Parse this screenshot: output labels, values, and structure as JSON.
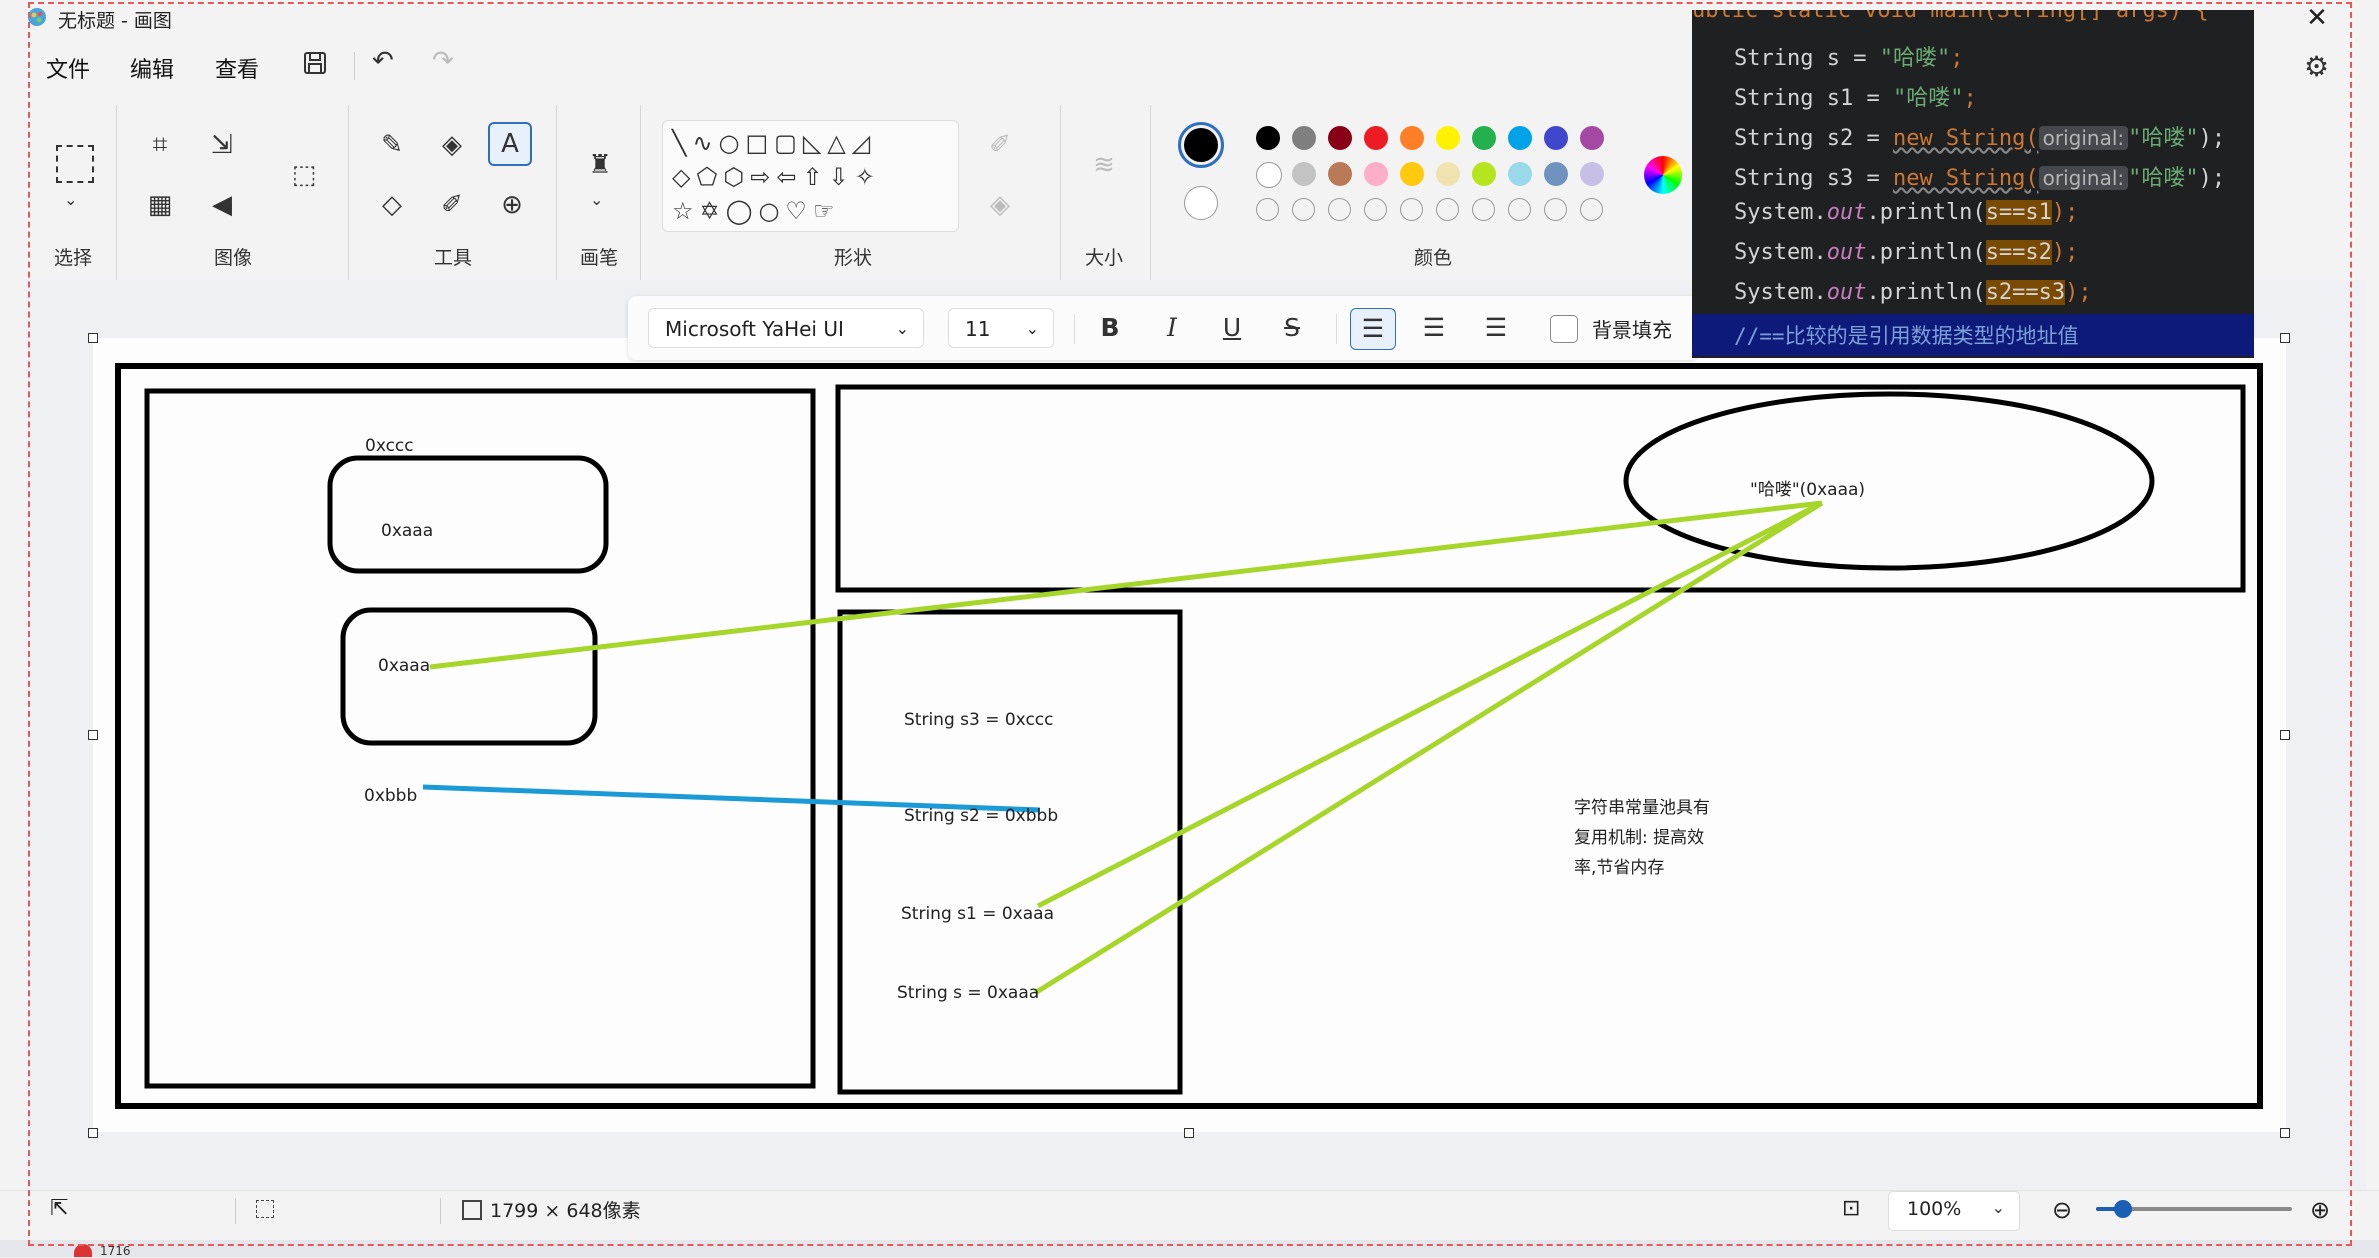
{
  "window": {
    "title": "无标题 - 画图",
    "close_glyph": "✕"
  },
  "menu": {
    "file": "文件",
    "edit": "编辑",
    "view": "查看"
  },
  "ribbon": {
    "groups": {
      "select": "选择",
      "image": "图像",
      "tools": "工具",
      "brush": "画笔",
      "shapes": "形状",
      "size": "大小",
      "colors": "颜色"
    },
    "palette_row1": [
      "#000000",
      "#7f7f7f",
      "#880015",
      "#ed1c24",
      "#ff7f27",
      "#fff200",
      "#22b14c",
      "#00a2e8",
      "#3f48cc",
      "#a349a4"
    ],
    "palette_row2": [
      "#ffffff",
      "#c3c3c3",
      "#b97a57",
      "#ffaec9",
      "#ffc90e",
      "#efe4b0",
      "#b5e61d",
      "#99d9ea",
      "#7092be",
      "#c8bfe7"
    ],
    "color1": "#000000",
    "color2": "#ffffff"
  },
  "text_toolbar": {
    "font": "Microsoft YaHei UI",
    "size": "11",
    "bold": "B",
    "italic": "I",
    "underline": "U",
    "strike": "S",
    "bg_fill": "背景填充"
  },
  "canvas_labels": {
    "addr_xccc": "0xccc",
    "addr_xaaa_1": "0xaaa",
    "addr_xaaa_2": "0xaaa",
    "addr_xbbb": "0xbbb",
    "pool_value": "\"哈喽\"(0xaaa)",
    "s3": "String s3 = 0xccc",
    "s2": "String s2 = 0xbbb",
    "s1": "String s1 = 0xaaa",
    "s": "String s = 0xaaa",
    "note_line1": "字符串常量池具有",
    "note_line2": "复用机制: 提高效",
    "note_line3": "率,节省内存"
  },
  "code": {
    "header": "ublic static void main(String[] args) {",
    "l1_a": "String s = ",
    "l1_str": "\"哈喽\"",
    "l1_end": ";",
    "l2_a": "String s1 = ",
    "l2_str": "\"哈喽\"",
    "l2_end": ";",
    "l3_a": "String s2 = ",
    "l3_new": "new String(",
    "l3_hint": "original:",
    "l3_str": "\"哈喽\"",
    "l3_end": ");",
    "l4_a": "String s3 = ",
    "l4_new": "new String(",
    "l4_hint": "original:",
    "l4_str": "\"哈喽\"",
    "l4_end": ");",
    "p_a": "System.",
    "p_out": "out",
    "p_b": ".println(",
    "c1": "s==s1",
    "c2": "s==s2",
    "c3": "s2==s3",
    "p_end": ");",
    "comment": "//==比较的是引用数据类型的地址值"
  },
  "status": {
    "canvas_size": "1799 × 648像素",
    "zoom": "100%"
  },
  "taskbar": {
    "badge_count": "1716"
  }
}
